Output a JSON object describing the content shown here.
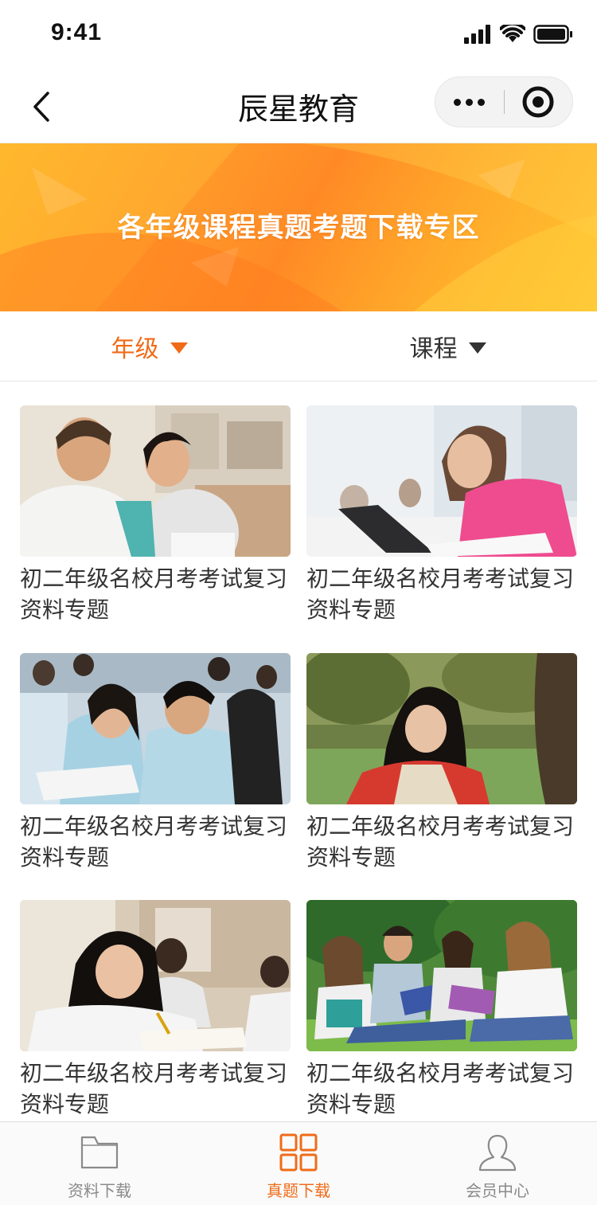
{
  "status_bar": {
    "time": "9:41"
  },
  "nav": {
    "title": "辰星教育"
  },
  "banner": {
    "text": "各年级课程真题考题下载专区"
  },
  "filters": [
    {
      "label": "年级",
      "active": true
    },
    {
      "label": "课程",
      "active": false
    }
  ],
  "cards": [
    {
      "title": "初二年级名校月考考试复习资料专题",
      "image": "tutor-student-photo"
    },
    {
      "title": "初二年级名校月考考试复习资料专题",
      "image": "girl-laptop-photo"
    },
    {
      "title": "初二年级名校月考考试复习资料专题",
      "image": "classroom-students-photo"
    },
    {
      "title": "初二年级名校月考考试复习资料专题",
      "image": "girl-outdoor-photo"
    },
    {
      "title": "初二年级名校月考考试复习资料专题",
      "image": "girl-writing-photo"
    },
    {
      "title": "初二年级名校月考考试复习资料专题",
      "image": "group-grass-photo"
    }
  ],
  "tab_bar": [
    {
      "label": "资料下载",
      "icon": "folder-icon",
      "active": false
    },
    {
      "label": "真题下载",
      "icon": "grid-icon",
      "active": true
    },
    {
      "label": "会员中心",
      "icon": "user-icon",
      "active": false
    }
  ],
  "colors": {
    "accent": "#f06b18",
    "banner_start": "#ffb327",
    "banner_end": "#ffc531"
  }
}
